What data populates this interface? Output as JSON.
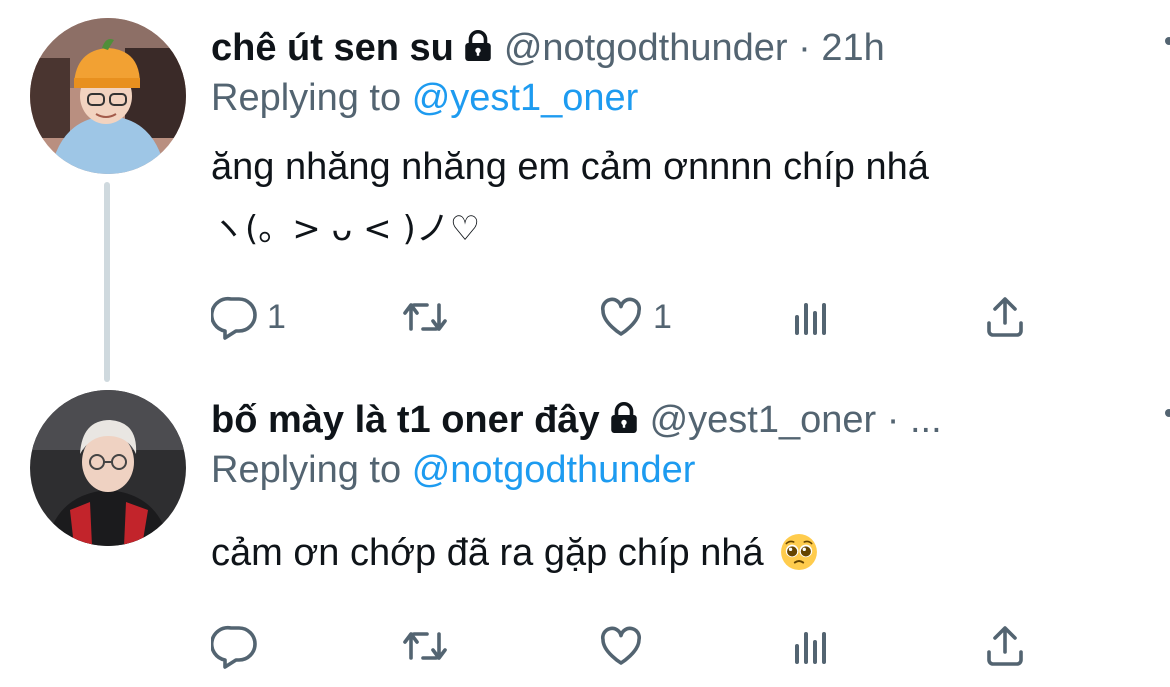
{
  "tweets": [
    {
      "display_name": "chê út sen su",
      "handle": "@notgodthunder",
      "separator": "·",
      "time": "21h",
      "replying_prefix": "Replying to",
      "replying_to": "@yest1_oner",
      "text_line1": "ăng nhăng nhăng em cảm ơnnnn chíp nhá",
      "text_line2": "ヽ(。> ᴗ < )ノ♡",
      "reply_count": "1",
      "retweet_count": "",
      "like_count": "1"
    },
    {
      "display_name": "bố mày là t1 oner đây",
      "handle": "@yest1_oner",
      "separator": "·",
      "time": "...",
      "replying_prefix": "Replying to",
      "replying_to": "@notgodthunder",
      "text_line1": "cảm ơn chớp đã ra gặp chíp nhá",
      "reply_count": "",
      "retweet_count": "",
      "like_count": ""
    }
  ],
  "colors": {
    "text": "#0f1419",
    "secondary": "#536471",
    "link": "#1d9bf0",
    "thread_line": "#cfd9de"
  },
  "icons": [
    "lock-icon",
    "more-icon",
    "reply-icon",
    "retweet-icon",
    "like-icon",
    "analytics-icon",
    "share-icon",
    "pleading-face-emoji"
  ]
}
